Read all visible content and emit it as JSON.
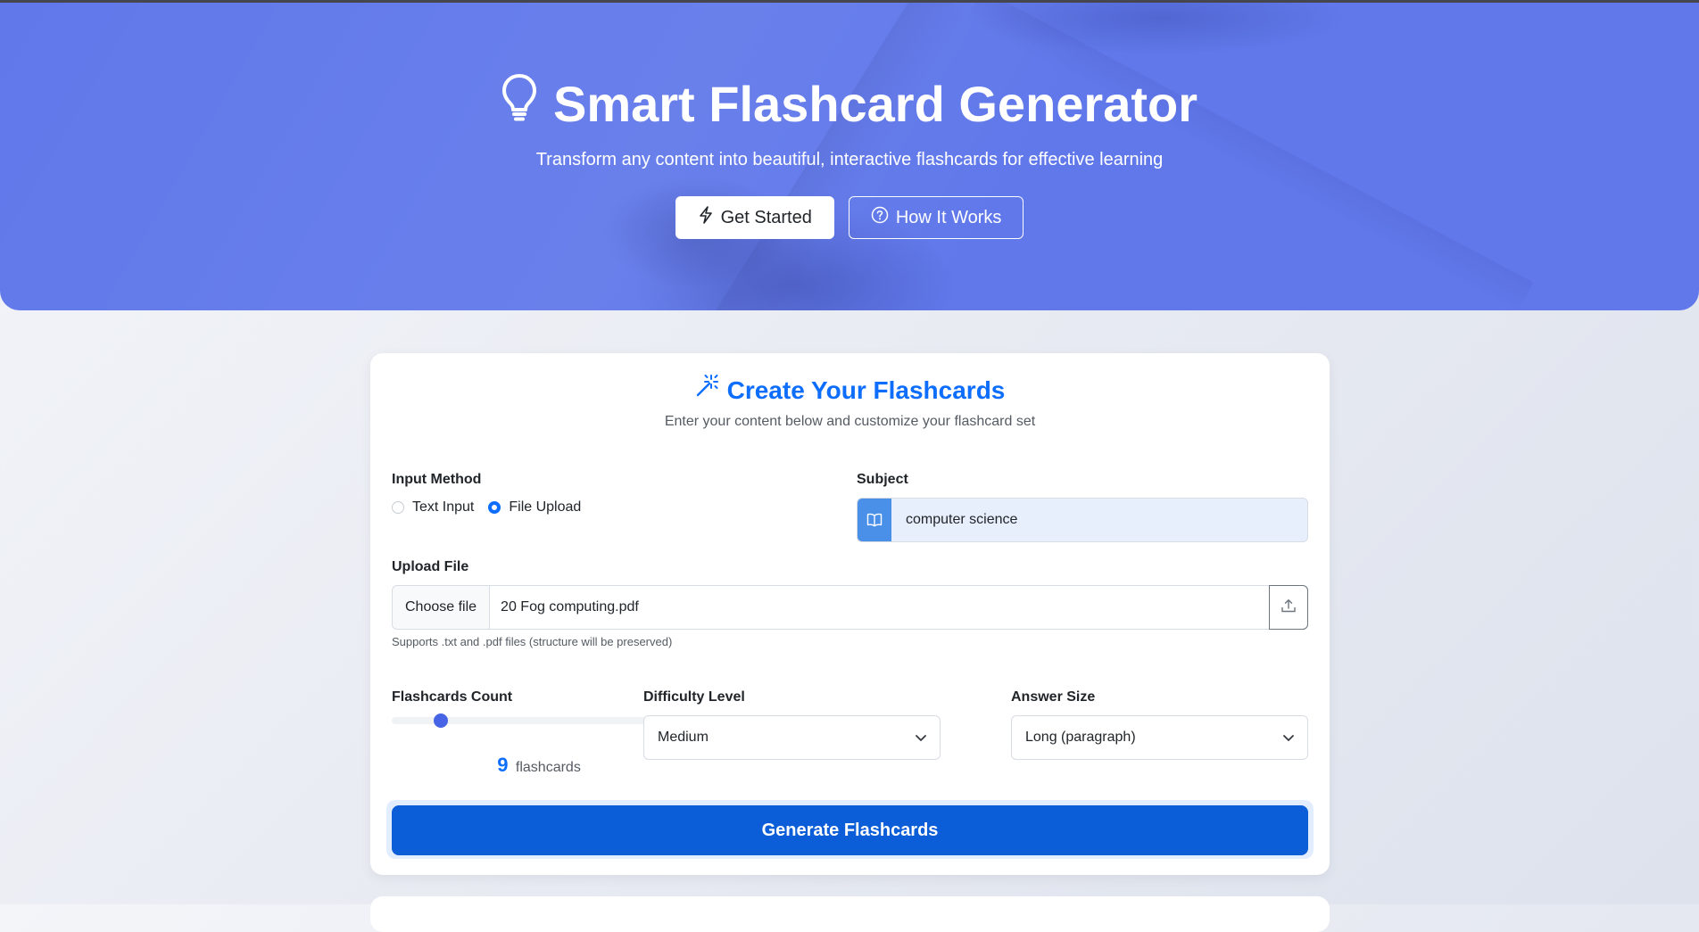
{
  "hero": {
    "title": "Smart Flashcard Generator",
    "subtitle": "Transform any content into beautiful, interactive flashcards for effective learning",
    "get_started_label": "Get Started",
    "how_it_works_label": "How It Works",
    "icons": {
      "title": "lightbulb-icon",
      "get_started": "lightning-icon",
      "how_it_works": "question-circle-icon"
    }
  },
  "form": {
    "title": "Create Your Flashcards",
    "title_icon": "magic-wand-icon",
    "subtitle": "Enter your content below and customize your flashcard set",
    "input_method": {
      "label": "Input Method",
      "options": [
        {
          "label": "Text Input",
          "selected": false
        },
        {
          "label": "File Upload",
          "selected": true
        }
      ]
    },
    "subject": {
      "label": "Subject",
      "value": "computer science",
      "icon": "book-icon"
    },
    "upload": {
      "label": "Upload File",
      "choose_label": "Choose file",
      "file_name": "20 Fog computing.pdf",
      "hint": "Supports .txt and .pdf files (structure will be preserved)",
      "button_icon": "upload-icon"
    },
    "count": {
      "label": "Flashcards Count",
      "value": "9",
      "unit": "flashcards",
      "slider_fraction": 0.15
    },
    "difficulty": {
      "label": "Difficulty Level",
      "value": "Medium"
    },
    "answer_size": {
      "label": "Answer Size",
      "value": "Long (paragraph)"
    },
    "generate_label": "Generate Flashcards"
  },
  "colors": {
    "hero_bg": "#6078ea",
    "primary": "#0d6efd",
    "button": "#0b5ed7",
    "subject_icon_bg": "#4a90e8"
  }
}
